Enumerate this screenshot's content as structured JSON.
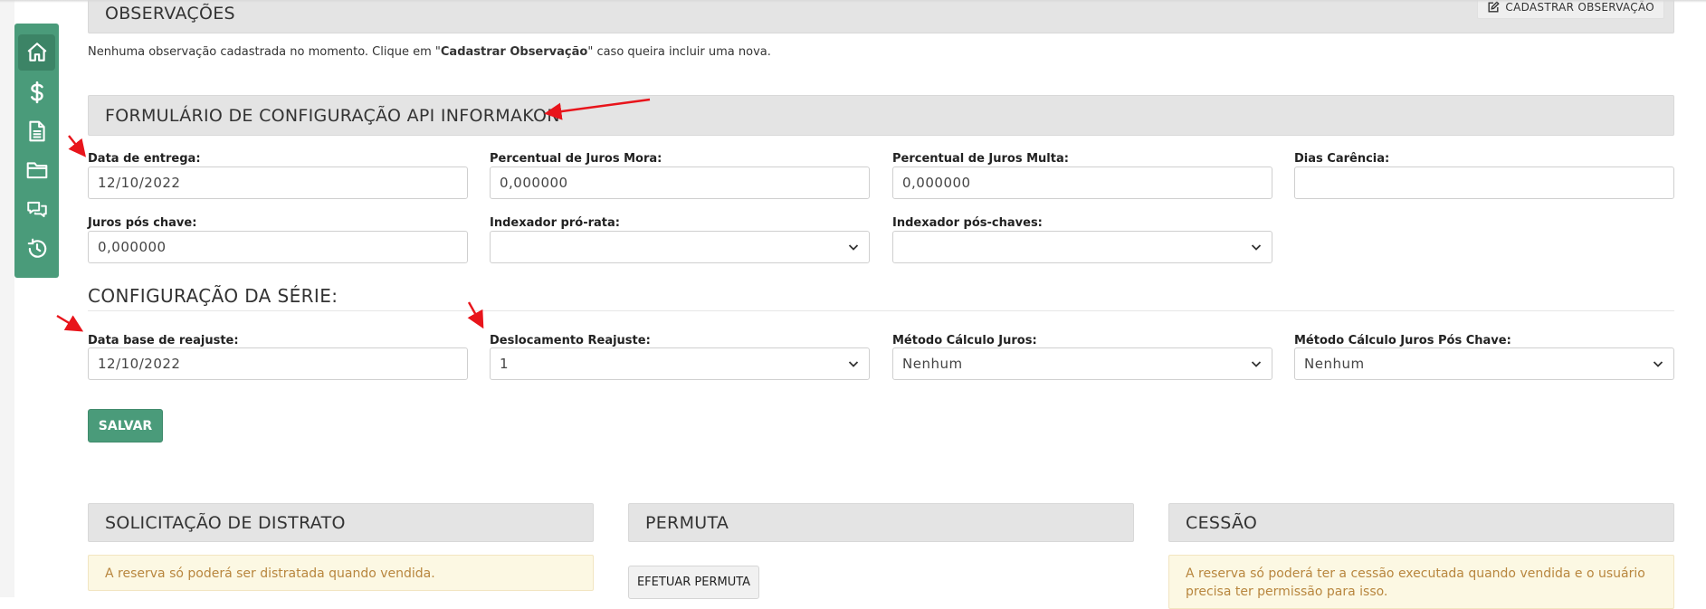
{
  "observacoes": {
    "title": "OBSERVAÇÕES",
    "button": "CADASTRAR OBSERVAÇÃO",
    "note_prefix": "Nenhuma observação cadastrada no momento. Clique em \"",
    "note_bold": "Cadastrar Observação",
    "note_suffix": "\" caso queira incluir uma nova."
  },
  "api_form": {
    "title": "FORMULÁRIO DE CONFIGURAÇÃO API INFORMAKON",
    "fields": {
      "data_entrega": {
        "label": "Data de entrega:",
        "value": "12/10/2022"
      },
      "juros_mora": {
        "label": "Percentual de Juros Mora:",
        "value": "0,000000"
      },
      "juros_multa": {
        "label": "Percentual de Juros Multa:",
        "value": "0,000000"
      },
      "dias_carencia": {
        "label": "Dias Carência:",
        "value": ""
      },
      "juros_pos_chave": {
        "label": "Juros pós chave:",
        "value": "0,000000"
      },
      "indexador_pro_rata": {
        "label": "Indexador pró-rata:",
        "value": ""
      },
      "indexador_pos_chaves": {
        "label": "Indexador pós-chaves:",
        "value": ""
      }
    }
  },
  "serie": {
    "title": "CONFIGURAÇÃO DA SÉRIE:",
    "fields": {
      "data_base": {
        "label": "Data base de reajuste:",
        "value": "12/10/2022"
      },
      "deslocamento": {
        "label": "Deslocamento Reajuste:",
        "value": "1"
      },
      "metodo_juros": {
        "label": "Método Cálculo Juros:",
        "value": "Nenhum"
      },
      "metodo_pos_chave": {
        "label": "Método Cálculo Juros Pós Chave:",
        "value": "Nenhum"
      }
    },
    "save_label": "SALVAR"
  },
  "distrato": {
    "title": "SOLICITAÇÃO DE DISTRATO",
    "alert": "A reserva só poderá ser distratada quando vendida."
  },
  "permuta": {
    "title": "PERMUTA",
    "button": "EFETUAR PERMUTA"
  },
  "cessao": {
    "title": "CESSÃO",
    "alert": "A reserva só poderá ter a cessão executada quando vendida e o usuário precisa ter permissão para isso."
  },
  "sidebar": {
    "icons": [
      "home-icon",
      "dollar-icon",
      "document-icon",
      "folder-icon",
      "chat-icon",
      "history-icon"
    ]
  },
  "colors": {
    "accent": "#4a9b7a",
    "panel_header": "#e4e4e4",
    "alert_bg": "#fcf8e3",
    "alert_text": "#b8863e",
    "annotation_arrow": "#e8141b"
  }
}
